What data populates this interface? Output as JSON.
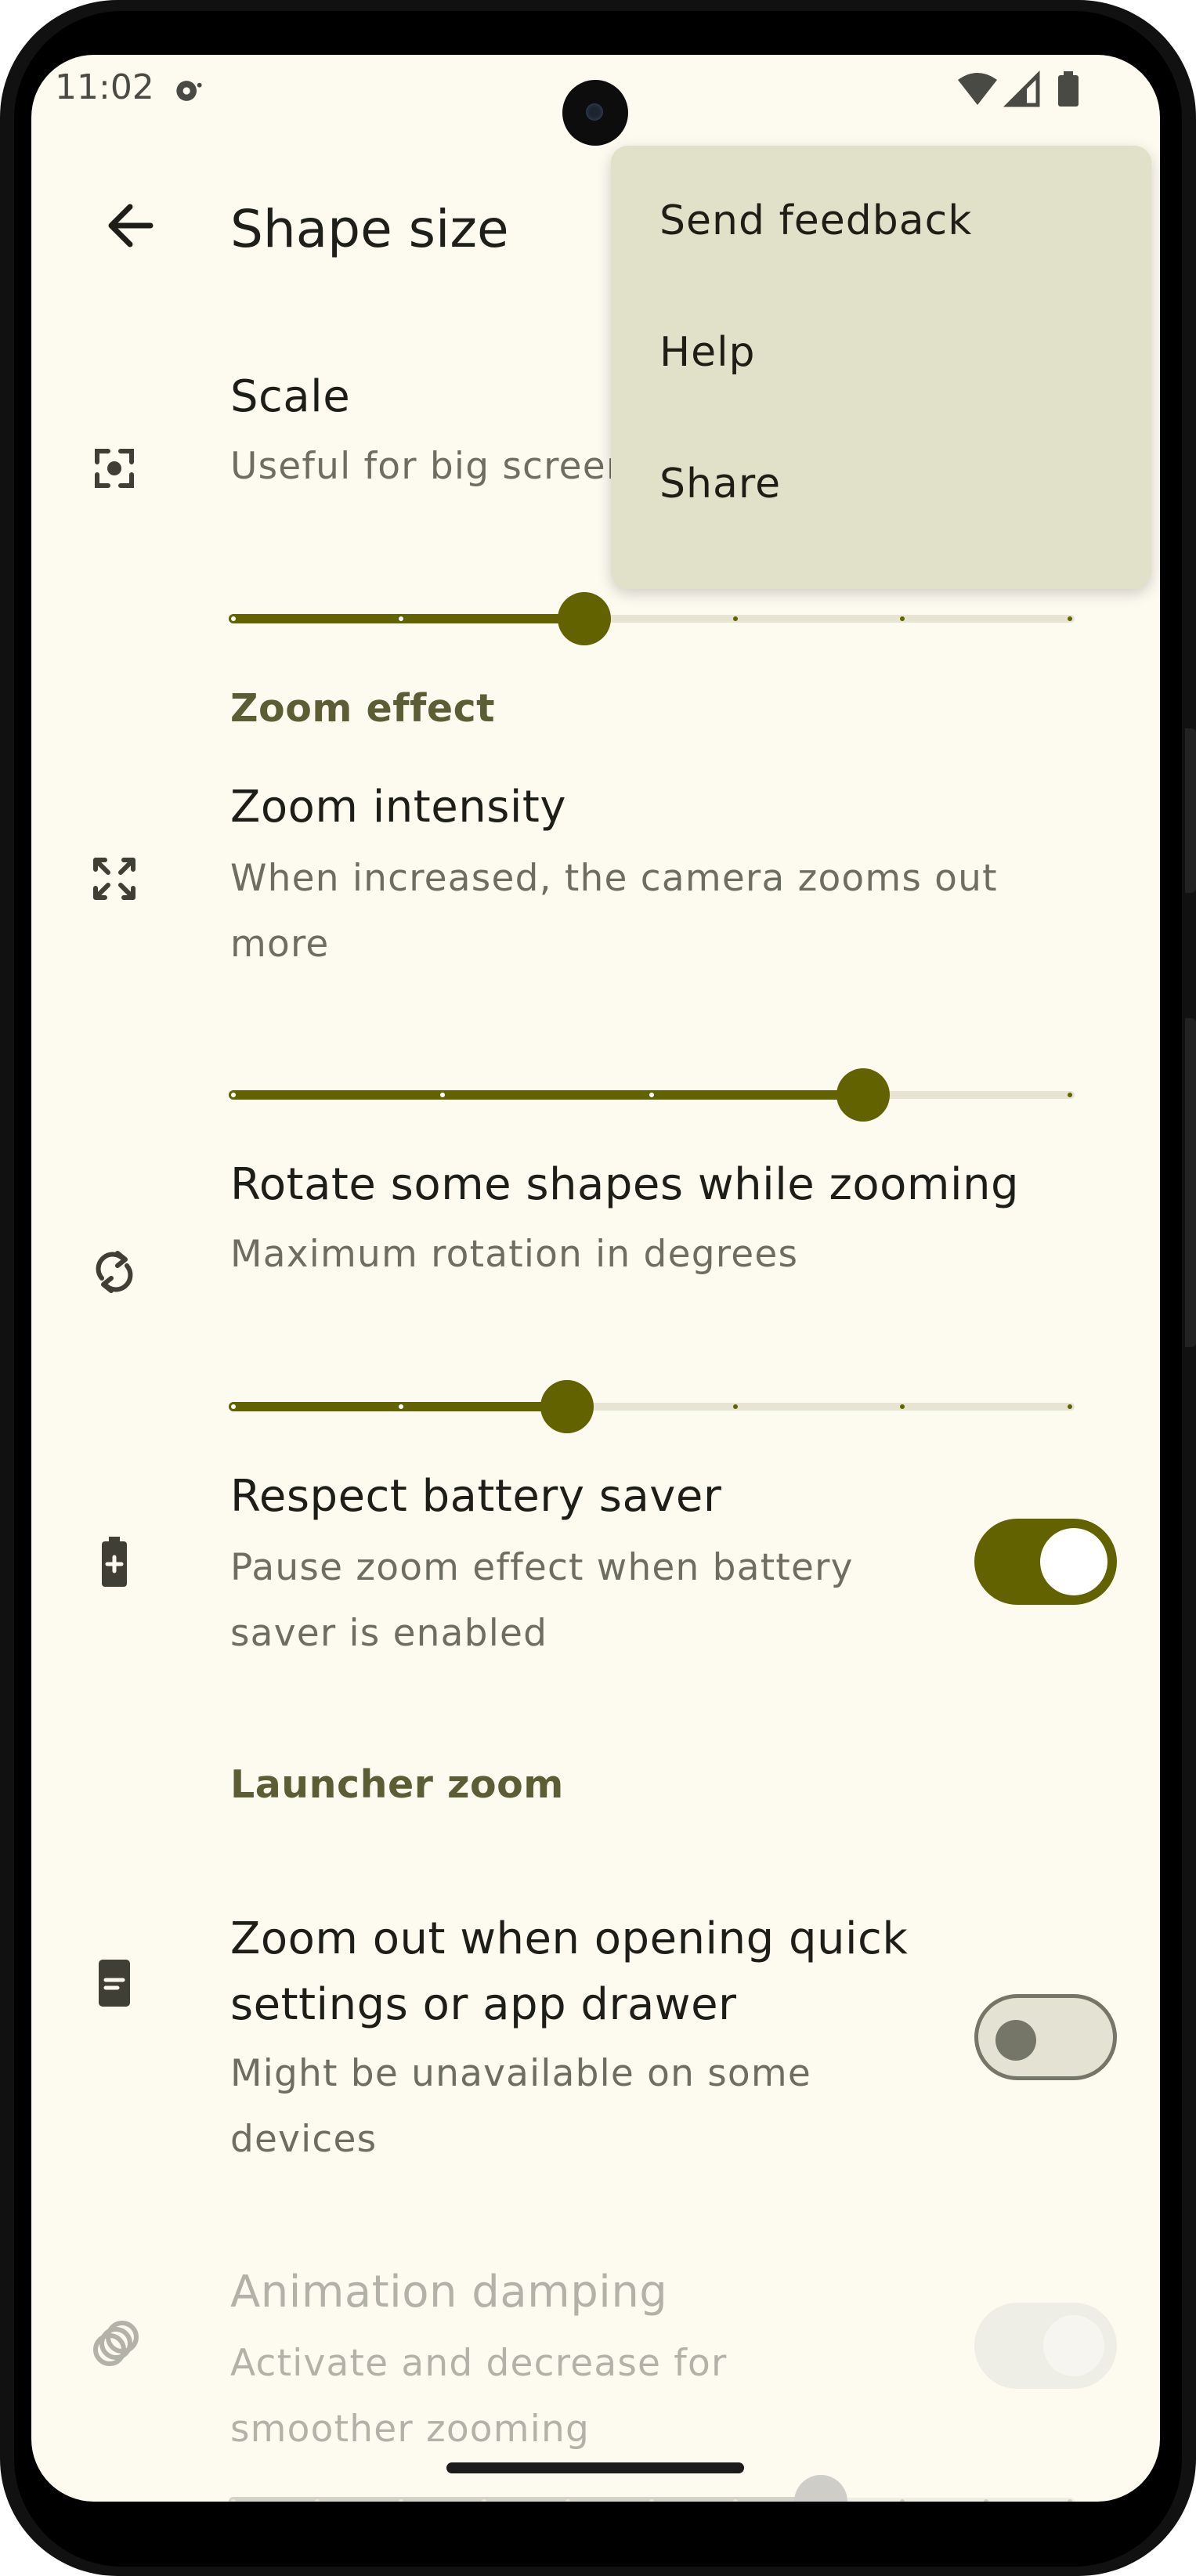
{
  "status_bar": {
    "time": "11:02"
  },
  "app_bar": {
    "title": "Shape size",
    "back_icon": "arrow-back-icon"
  },
  "settings": {
    "scale": {
      "title": "Scale",
      "summary": "Useful for big screens",
      "icon": "center-focus-icon",
      "slider_value_fraction": 0.42
    },
    "zoom_effect_header": "Zoom effect",
    "zoom_intensity": {
      "title": "Zoom intensity",
      "summary": "When increased, the camera zooms out more",
      "icon": "zoom-out-map-icon",
      "slider_value_fraction": 0.75
    },
    "rotate_shapes": {
      "title": "Rotate some shapes while zooming",
      "summary": "Maximum rotation in degrees",
      "icon": "rotate-icon",
      "slider_value_fraction": 0.4
    },
    "battery_saver": {
      "title": "Respect battery saver",
      "summary": "Pause zoom effect when battery saver is enabled",
      "icon": "battery-charging-icon",
      "enabled": true
    },
    "launcher_zoom_header": "Launcher zoom",
    "launcher_zoom_out": {
      "title": "Zoom out when opening quick settings or app drawer",
      "summary": "Might be unavailable on some devices",
      "icon": "app-drawer-icon",
      "enabled": false
    },
    "animation_damping": {
      "title": "Animation damping",
      "summary": "Activate and decrease for smoother zooming",
      "icon": "damping-rings-icon",
      "enabled": true,
      "disabled": true,
      "slider_value_fraction": 0.7
    }
  },
  "menu": {
    "items": [
      {
        "label": "Send feedback"
      },
      {
        "label": "Help"
      },
      {
        "label": "Share"
      }
    ]
  },
  "colors": {
    "accent": "#626200",
    "background": "#fdfaf0",
    "menu_background": "#e1e0c8"
  }
}
